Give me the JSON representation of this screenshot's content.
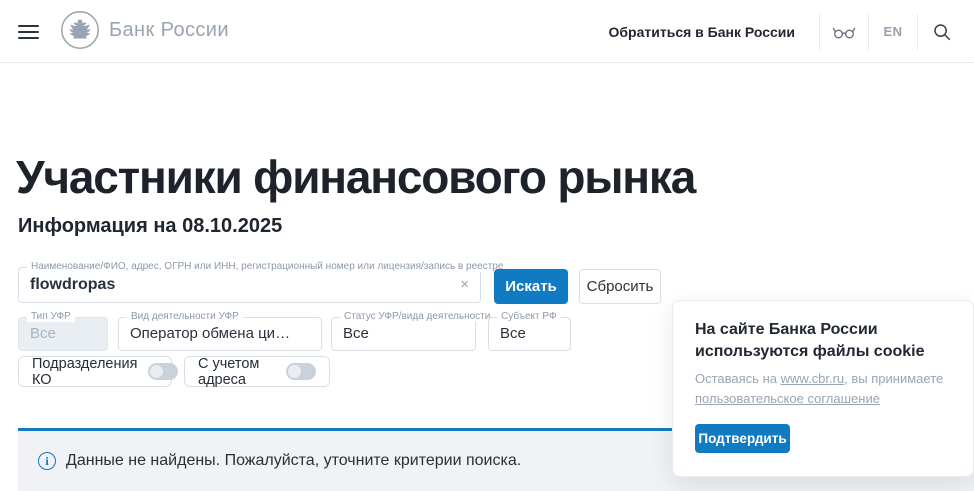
{
  "colors": {
    "accent": "#107ac2"
  },
  "header": {
    "brand": "Банк России",
    "contact_link": "Обратиться в Банк России",
    "lang": "EN"
  },
  "page": {
    "title": "Участники финансового рынка",
    "subtitle": "Информация на 08.10.2025"
  },
  "search": {
    "label": "Наименование/ФИО, адрес, ОГРН или ИНН, регистрационный номер или лицензия/запись в реестре",
    "value": "flowdropas",
    "search_button": "Искать",
    "reset_button": "Сбросить"
  },
  "filters": [
    {
      "label": "Тип УФР",
      "value": "Все",
      "disabled": true
    },
    {
      "label": "Вид деятельности УФР",
      "value": "Оператор обмена цифровых ...",
      "disabled": false
    },
    {
      "label": "Статус УФР/вида деятельности",
      "value": "Все",
      "disabled": false
    },
    {
      "label": "Субъект РФ",
      "value": "Все",
      "disabled": false
    }
  ],
  "toggles": [
    {
      "label": "Подразделения КО",
      "on": false
    },
    {
      "label": "С учетом адреса",
      "on": false
    }
  ],
  "alert": {
    "text": "Данные не найдены. Пожалуйста, уточните критерии поиска."
  },
  "cookie": {
    "title": "На сайте Банка России используются файлы cookie",
    "body_prefix": "Оставаясь на ",
    "link1": "www.cbr.ru",
    "body_middle": ", вы принимаете ",
    "link2": "пользовательское соглашение",
    "confirm_button": "Подтвердить"
  },
  "icons": {
    "info": "i",
    "clear": "×"
  }
}
